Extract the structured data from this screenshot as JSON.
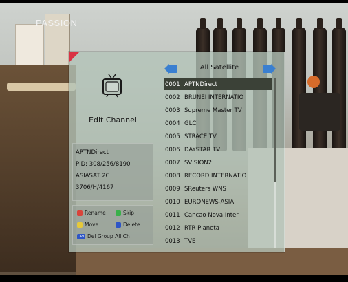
{
  "background": {
    "overlay_text": "PASSION"
  },
  "panel": {
    "title": "Edit Channel",
    "accent_color": "#d93344",
    "selected_row_color": "#3b4137",
    "tv_icon": "tv-icon"
  },
  "info": {
    "line1": "APTNDirect",
    "line2": "PID: 308/256/8190",
    "line3": "ASIASAT 2C",
    "line4": "3706/H/4167"
  },
  "keys": {
    "rename": "Rename",
    "skip": "Skip",
    "move": "Move",
    "delete": "Delete",
    "opt_badge": "OPT",
    "group": "Del Group All Ch",
    "colors": {
      "red": "#d9443b",
      "green": "#39b04a",
      "yellow": "#e6c93a",
      "blue": "#2e55c6"
    }
  },
  "list": {
    "header": "All Satellite",
    "items": [
      {
        "num": "0001",
        "name": "APTNDirect",
        "selected": true
      },
      {
        "num": "0002",
        "name": "BRUNEI INTERNATIO"
      },
      {
        "num": "0003",
        "name": "Supreme Master TV"
      },
      {
        "num": "0004",
        "name": "GLC"
      },
      {
        "num": "0005",
        "name": "STRACE TV"
      },
      {
        "num": "0006",
        "name": "DAYSTAR TV"
      },
      {
        "num": "0007",
        "name": "SVISION2"
      },
      {
        "num": "0008",
        "name": "RECORD INTERNATIO"
      },
      {
        "num": "0009",
        "name": "SReuters WNS"
      },
      {
        "num": "0010",
        "name": "EURONEWS-ASIA"
      },
      {
        "num": "0011",
        "name": "Cancao Nova Inter"
      },
      {
        "num": "0012",
        "name": "RTR Planeta"
      },
      {
        "num": "0013",
        "name": "TVE"
      }
    ]
  }
}
